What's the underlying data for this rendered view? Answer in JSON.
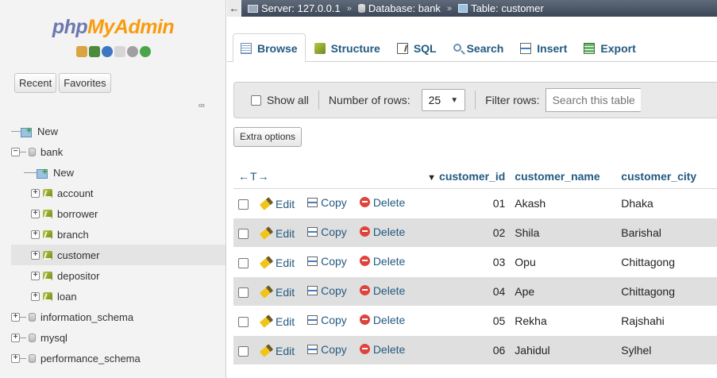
{
  "logo": {
    "part1": "php",
    "part2": "MyAdmin"
  },
  "logo_icons": [
    "home-icon",
    "database-icon",
    "info-icon",
    "docs-icon",
    "settings-icon",
    "reload-icon"
  ],
  "nav_tabs": {
    "recent": "Recent",
    "favorites": "Favorites"
  },
  "tree": {
    "new_root": "New",
    "bank": "bank",
    "bank_new": "New",
    "tables": [
      "account",
      "borrower",
      "branch",
      "customer",
      "depositor",
      "loan"
    ],
    "databases": [
      "information_schema",
      "mysql",
      "performance_schema"
    ]
  },
  "breadcrumb": {
    "server": "Server: 127.0.0.1",
    "database": "Database: bank",
    "table": "Table: customer",
    "separator": "»"
  },
  "tabs": [
    "Browse",
    "Structure",
    "SQL",
    "Search",
    "Insert",
    "Export"
  ],
  "toolbar": {
    "show_all": "Show all",
    "rows_label": "Number of rows:",
    "rows_value": "25",
    "filter_label": "Filter rows:",
    "filter_placeholder": "Search this table"
  },
  "extra_options": "Extra options",
  "table": {
    "columns": [
      "customer_id",
      "customer_name",
      "customer_city"
    ],
    "actions": {
      "edit": "Edit",
      "copy": "Copy",
      "delete": "Delete"
    },
    "rows": [
      {
        "customer_id": "01",
        "customer_name": "Akash",
        "customer_city": "Dhaka"
      },
      {
        "customer_id": "02",
        "customer_name": "Shila",
        "customer_city": "Barishal"
      },
      {
        "customer_id": "03",
        "customer_name": "Opu",
        "customer_city": "Chittagong"
      },
      {
        "customer_id": "04",
        "customer_name": "Ape",
        "customer_city": "Chittagong"
      },
      {
        "customer_id": "05",
        "customer_name": "Rekha",
        "customer_city": "Rajshahi"
      },
      {
        "customer_id": "06",
        "customer_name": "Jahidul",
        "customer_city": "Sylhel"
      }
    ]
  },
  "colors": {
    "link": "#235a81",
    "logo_blue": "#6c78af",
    "logo_orange": "#f89c0e",
    "header_bar": "#4b5767"
  }
}
